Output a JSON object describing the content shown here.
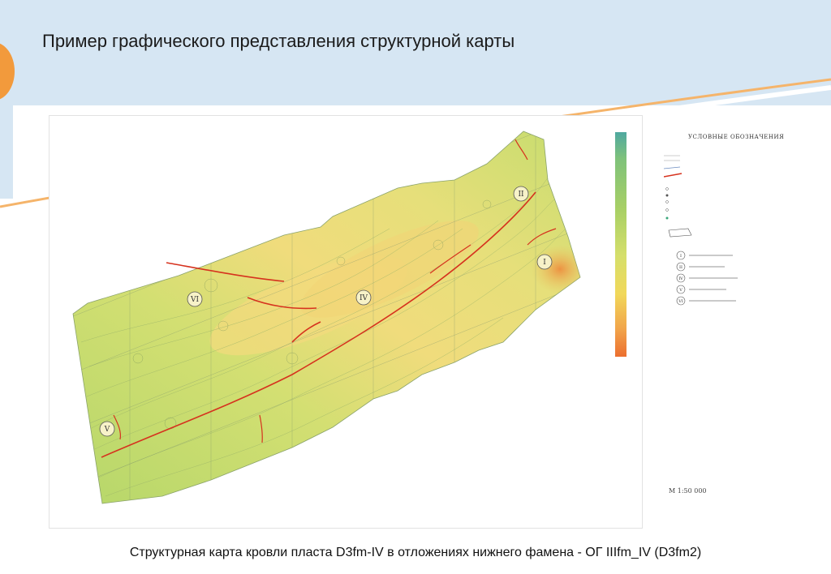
{
  "slide": {
    "title": "Пример графического представления структурной карты",
    "caption": "Структурная карта кровли пласта D3fm-IV в отложениях нижнего фамена - ОГ IIIfm_IV (D3fm2)"
  },
  "map": {
    "legend_title": "УСЛОВНЫЕ ОБОЗНАЧЕНИЯ",
    "scale_label": "М 1:50 000",
    "field_numerals": [
      "I",
      "II",
      "IV",
      "V",
      "VI"
    ],
    "field_legend": [
      {
        "numeral": "I"
      },
      {
        "numeral": "II"
      },
      {
        "numeral": "IV"
      },
      {
        "numeral": "V"
      },
      {
        "numeral": "VI"
      }
    ],
    "colors": {
      "deep": "#4fa8a0",
      "green": "#a9d065",
      "yellow": "#f1d85a",
      "orange": "#ec6f2f",
      "fault": "#d6321e",
      "accent": "#f29a3c",
      "header": "#d6e6f3"
    }
  }
}
